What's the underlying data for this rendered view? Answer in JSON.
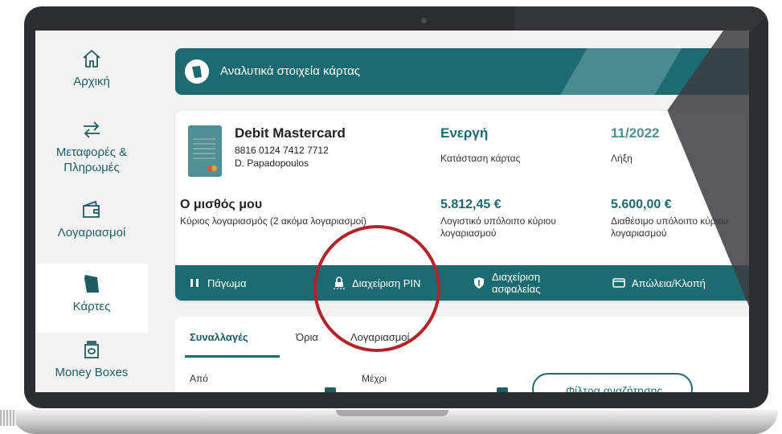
{
  "sidebar": {
    "items": [
      {
        "label": "Αρχική",
        "icon": "home-icon"
      },
      {
        "label": "Μεταφορές & Πληρωμές",
        "icon": "transfer-arrows-icon"
      },
      {
        "label": "Λογαριασμοί",
        "icon": "wallet-icon"
      },
      {
        "label": "Κάρτες",
        "icon": "card-icon",
        "active": true
      },
      {
        "label": "Money Boxes",
        "icon": "money-box-icon"
      }
    ]
  },
  "banner": {
    "title": "Αναλυτικά στοιχεία κάρτας",
    "icon": "card-icon"
  },
  "card": {
    "name": "Debit Mastercard",
    "number": "8816 0124 7412 7712",
    "holder": "D. Papadopoulos",
    "status_value": "Ενεργή",
    "status_label": "Κατάσταση κάρτας",
    "expiry_value": "11/2022",
    "expiry_label": "Λήξη"
  },
  "account": {
    "name": "Ο μισθός μου",
    "subtitle": "Κύριος λογαριασμός (2 ακόμα λογαριασμοί)",
    "ledger_value": "5.812,45 €",
    "ledger_label": "Λογιστικό υπόλοιπο κύριου λογαριασμού",
    "available_value": "5.600,00 €",
    "available_label": "Διαθέσιμο υπόλοιπο κύριου λογαριασμού"
  },
  "actions": {
    "freeze": "Πάγωμα",
    "pin": "Διαχείριση PIN",
    "security": "Διαχείριση ασφαλείας",
    "lost": "Απώλεια/Κλοπή"
  },
  "tabs": {
    "transactions": "Συναλλαγές",
    "limits": "Όρια",
    "accounts": "Λογαριασμοί"
  },
  "filters": {
    "from_label": "Από",
    "to_label": "Μέχρι",
    "search_filters_button": "Φίλτρα αναζήτησης"
  },
  "colors": {
    "primary": "#1d6b72",
    "secondary": "#4f8f95",
    "highlight": "#b3232a",
    "background": "#f2f2f2"
  }
}
